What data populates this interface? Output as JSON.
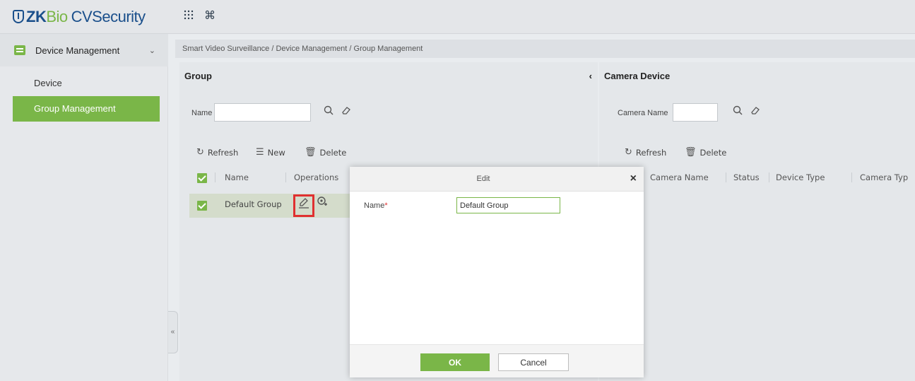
{
  "app": {
    "logo_zk": "ZK",
    "logo_bio": "Bio",
    "logo_rest": "CVSecurity",
    "apps_icon": "grid-icon",
    "command_icon": "command-icon"
  },
  "sidebar": {
    "section_label": "Device Management",
    "items": [
      {
        "label": "Device"
      },
      {
        "label": "Group Management"
      }
    ]
  },
  "breadcrumb": "Smart Video Surveillance / Device Management / Group Management",
  "group_panel": {
    "title": "Group",
    "collapse_glyph": "‹",
    "search_label": "Name",
    "search_value": "",
    "toolbar": {
      "refresh": "Refresh",
      "new": "New",
      "delete": "Delete"
    },
    "columns": [
      "Name",
      "Operations"
    ],
    "rows": [
      {
        "name": "Default Group"
      }
    ]
  },
  "camera_panel": {
    "title": "Camera Device",
    "search_label": "Camera Name",
    "search_value": "",
    "toolbar": {
      "refresh": "Refresh",
      "delete": "Delete"
    },
    "columns": [
      "Camera Name",
      "Status",
      "Device Type",
      "Camera Typ"
    ]
  },
  "modal": {
    "title": "Edit",
    "close": "×",
    "name_label": "Name",
    "required_mark": "*",
    "name_value": "Default Group",
    "ok_label": "OK",
    "cancel_label": "Cancel"
  },
  "colors": {
    "accent_green": "#7ab648",
    "brand_blue": "#1a4f8b",
    "highlight_red": "#e03030"
  }
}
